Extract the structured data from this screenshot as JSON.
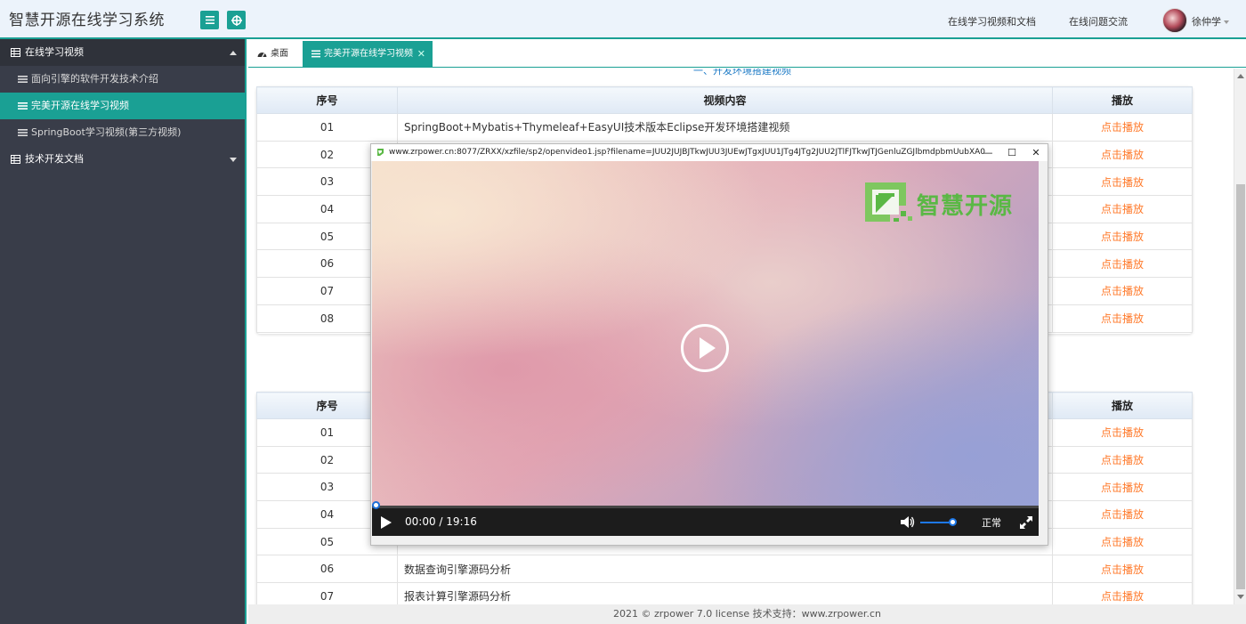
{
  "app": {
    "title": "智慧开源在线学习系统"
  },
  "header": {
    "links": [
      "在线学习视频和文档",
      "在线问题交流"
    ],
    "user_name": "徐仲学"
  },
  "sidebar": {
    "items": [
      {
        "label": "在线学习视频",
        "type": "group",
        "expanded": true
      },
      {
        "label": "面向引擎的软件开发技术介绍",
        "type": "sub"
      },
      {
        "label": "完美开源在线学习视频",
        "type": "sub",
        "active": true
      },
      {
        "label": "SpringBoot学习视频(第三方视频)",
        "type": "sub"
      },
      {
        "label": "技术开发文档",
        "type": "group",
        "expanded": false
      }
    ]
  },
  "tabs": [
    {
      "label": "桌面"
    },
    {
      "label": "完美开源在线学习视频",
      "active": true,
      "close": "✕"
    }
  ],
  "content": {
    "cut_title": "一、开发环境搭建视频",
    "table1": {
      "headers": [
        "序号",
        "视频内容",
        "播放"
      ],
      "rows": [
        {
          "num": "01",
          "desc": "SpringBoot+Mybatis+Thymeleaf+EasyUI技术版本Eclipse开发环境搭建视频",
          "play": "点击播放"
        },
        {
          "num": "02",
          "desc": "",
          "play": "点击播放"
        },
        {
          "num": "03",
          "desc": "",
          "play": "点击播放"
        },
        {
          "num": "04",
          "desc": "",
          "play": "点击播放"
        },
        {
          "num": "05",
          "desc": "",
          "play": "点击播放"
        },
        {
          "num": "06",
          "desc": "",
          "play": "点击播放"
        },
        {
          "num": "07",
          "desc": "",
          "play": "点击播放"
        },
        {
          "num": "08",
          "desc": "",
          "play": "点击播放"
        }
      ]
    },
    "table2": {
      "headers": [
        "序号",
        "",
        "播放"
      ],
      "rows": [
        {
          "num": "01",
          "desc": "",
          "play": "点击播放"
        },
        {
          "num": "02",
          "desc": "",
          "play": "点击播放"
        },
        {
          "num": "03",
          "desc": "",
          "play": "点击播放"
        },
        {
          "num": "04",
          "desc": "",
          "play": "点击播放"
        },
        {
          "num": "05",
          "desc": "",
          "play": "点击播放"
        },
        {
          "num": "06",
          "desc": "数据查询引擎源码分析",
          "play": "点击播放"
        },
        {
          "num": "07",
          "desc": "报表计算引擎源码分析",
          "play": "点击播放"
        }
      ]
    }
  },
  "popup": {
    "url": "www.zrpower.cn:8077/ZRXX/xzfile/sp2/openvideo1.jsp?filename=JUU2JUJBJTkwJUU3JUEwJTgxJUU1JTg4JTg2JUU2JTlFJTkwJTJGenluZGJlbmdpbmUubXA0",
    "logo_text": "智慧开源",
    "time": "00:00 / 19:16",
    "speed": "正常",
    "progress": 0,
    "volume": 0.8,
    "window_buttons": {
      "minimize": "—",
      "maximize": "☐",
      "close": "✕"
    }
  },
  "footer": {
    "text": "2021 © zrpower 7.0 license 技术支持：www.zrpower.cn"
  },
  "colors": {
    "accent": "#1aa094",
    "sidebar": "#393d49",
    "play_link": "#ff7a2b",
    "header_bg": "#ecf3fb"
  }
}
